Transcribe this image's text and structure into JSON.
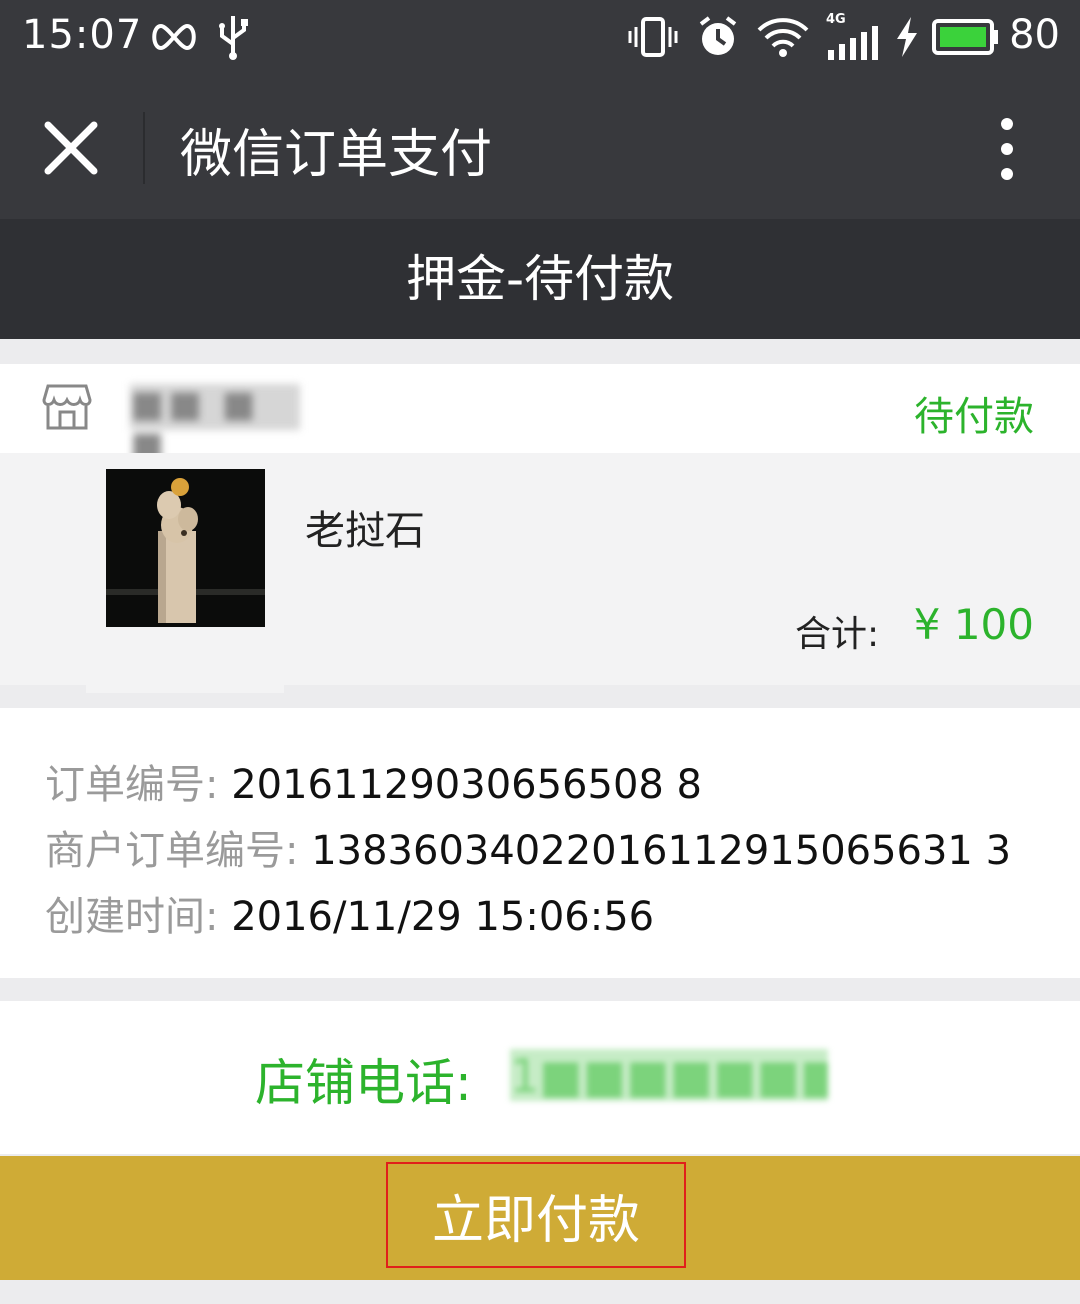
{
  "status_bar": {
    "time": "15:07",
    "network": "4G",
    "battery": "80",
    "icons": [
      "infinity-icon",
      "usb-icon",
      "vibrate-icon",
      "alarm-icon",
      "wifi-icon",
      "signal-icon",
      "charging-icon",
      "battery-icon"
    ]
  },
  "title_bar": {
    "title": "微信订单支付",
    "close_icon": "close-icon",
    "more_icon": "more-vertical-icon"
  },
  "sub_header": {
    "text": "押金-待付款"
  },
  "store": {
    "icon": "store-icon",
    "name": "■■ ■ ■",
    "status": "待付款",
    "status_color": "#2cb32c"
  },
  "item": {
    "name": "老挝石",
    "total_label": "合计:",
    "total_value": "¥ 100"
  },
  "order": {
    "number_label": "订单编号:",
    "number": "20161129030656508 8",
    "merchant_label": "商户订单编号:",
    "merchant_number": "13836034022016112915065631 3",
    "created_label": "创建时间:",
    "created_time": "2016/11/29 15:06:56"
  },
  "shop_phone": {
    "label": "店铺电话:",
    "value": "1■■■■■■■■■2"
  },
  "pay": {
    "label": "立即付款",
    "bar_color": "#cfab36"
  }
}
